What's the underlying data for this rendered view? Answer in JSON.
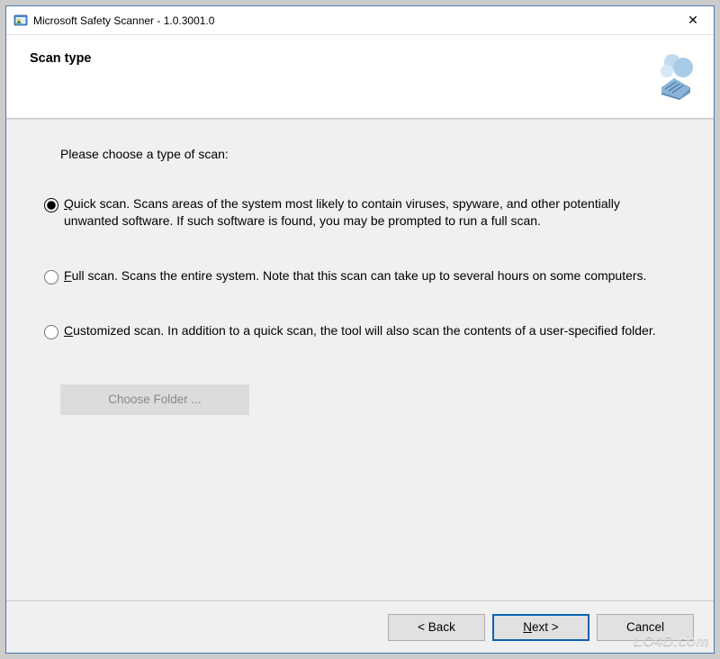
{
  "titlebar": {
    "title": "Microsoft Safety Scanner - 1.0.3001.0",
    "close_glyph": "✕"
  },
  "header": {
    "title": "Scan type"
  },
  "content": {
    "intro": "Please choose a type of scan:",
    "options": [
      {
        "id": "quick",
        "label": "Quick scan. Scans areas of the system most likely to contain viruses, spyware, and other potentially unwanted software. If such software is found, you may be prompted to run a full scan.",
        "checked": true
      },
      {
        "id": "full",
        "label": "Full scan. Scans the entire system. Note that this scan can take up to several hours on some computers.",
        "checked": false
      },
      {
        "id": "custom",
        "label": "Customized scan. In addition to a quick scan, the tool will also scan the contents of a user-specified folder.",
        "checked": false
      }
    ],
    "choose_folder_label": "Choose Folder ...",
    "choose_folder_enabled": false
  },
  "footer": {
    "back": "< Back",
    "next_prefix": "N",
    "next_suffix": "ext >",
    "cancel": "Cancel"
  },
  "watermark": "LO4D.com"
}
